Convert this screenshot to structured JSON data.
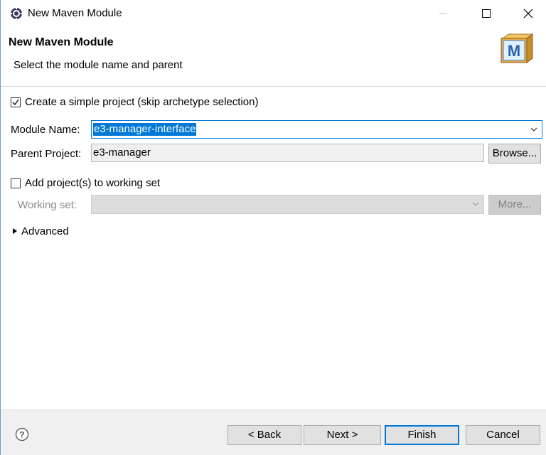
{
  "window": {
    "title": "New Maven Module",
    "icon": "eclipse-gear-icon"
  },
  "header": {
    "title": "New Maven Module",
    "description": "Select the module name and parent",
    "logo_icon": "maven-m-icon",
    "logo_letter": "M"
  },
  "form": {
    "simple_project": {
      "label": "Create a simple project (skip archetype selection)",
      "checked": true
    },
    "module_name": {
      "label": "Module Name:",
      "value": "e3-manager-interface"
    },
    "parent_project": {
      "label": "Parent Project:",
      "value": "e3-manager",
      "browse_label": "Browse..."
    },
    "working_set_toggle": {
      "label": "Add project(s) to working set",
      "checked": false
    },
    "working_set": {
      "label": "Working set:",
      "value": "",
      "more_label": "More..."
    },
    "advanced": {
      "label": "Advanced"
    }
  },
  "footer": {
    "help_icon": "help-question-icon",
    "back_label": "< Back",
    "next_label": "Next >",
    "finish_label": "Finish",
    "cancel_label": "Cancel"
  },
  "colors": {
    "accent": "#0078d7",
    "button_bg": "#e1e1e1",
    "footer_bg": "#f0f0f0",
    "disabled_bg": "#cccccc"
  }
}
